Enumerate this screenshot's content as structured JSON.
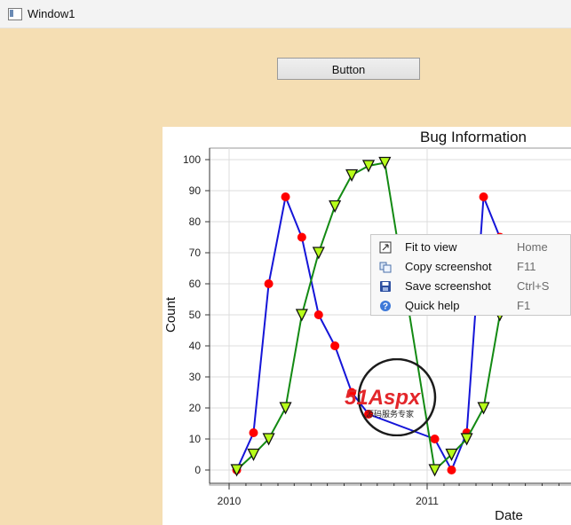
{
  "window": {
    "title": "Window1"
  },
  "toolbar": {
    "button_label": "Button"
  },
  "chart_data": {
    "type": "line",
    "title": "Bug Information",
    "xlabel": "Date",
    "ylabel": "Count",
    "ylim": [
      0,
      100
    ],
    "yticks": [
      0,
      10,
      20,
      30,
      40,
      50,
      60,
      70,
      80,
      90,
      100
    ],
    "xtick_labels": [
      "2010",
      "2011"
    ],
    "grid": true,
    "series": [
      {
        "color": "#1515d8",
        "marker": "circle",
        "marker_color": "#ff0000",
        "x": [
          "2010-01-15",
          "2010-02-15",
          "2010-03-15",
          "2010-04-15",
          "2010-05-15",
          "2010-06-15",
          "2010-07-15",
          "2010-08-15",
          "2010-09-15",
          "2011-01-15",
          "2011-02-15",
          "2011-03-15",
          "2011-04-15",
          "2011-05-15"
        ],
        "values": [
          0,
          12,
          60,
          88,
          75,
          50,
          40,
          25,
          18,
          10,
          0,
          12,
          88,
          75
        ]
      },
      {
        "color": "#138a13",
        "marker": "triangle-down",
        "marker_color": "#b7ff1a",
        "x": [
          "2010-01-15",
          "2010-02-15",
          "2010-03-15",
          "2010-04-15",
          "2010-05-15",
          "2010-06-15",
          "2010-07-15",
          "2010-08-15",
          "2010-09-15",
          "2010-10-15",
          "2011-01-15",
          "2011-02-15",
          "2011-03-15",
          "2011-04-15",
          "2011-05-15"
        ],
        "values": [
          0,
          5,
          10,
          20,
          50,
          70,
          85,
          95,
          98,
          99,
          0,
          5,
          10,
          20,
          50
        ]
      }
    ]
  },
  "context_menu": {
    "items": [
      {
        "label": "Fit to view",
        "shortcut": "Home",
        "icon": "fit-to-view-icon"
      },
      {
        "label": "Copy screenshot",
        "shortcut": "F11",
        "icon": "copy-icon"
      },
      {
        "label": "Save screenshot",
        "shortcut": "Ctrl+S",
        "icon": "save-icon"
      },
      {
        "label": "Quick help",
        "shortcut": "F1",
        "icon": "help-icon"
      }
    ]
  },
  "watermark": {
    "brand": "51Aspx",
    "tagline": "源码服务专家"
  }
}
